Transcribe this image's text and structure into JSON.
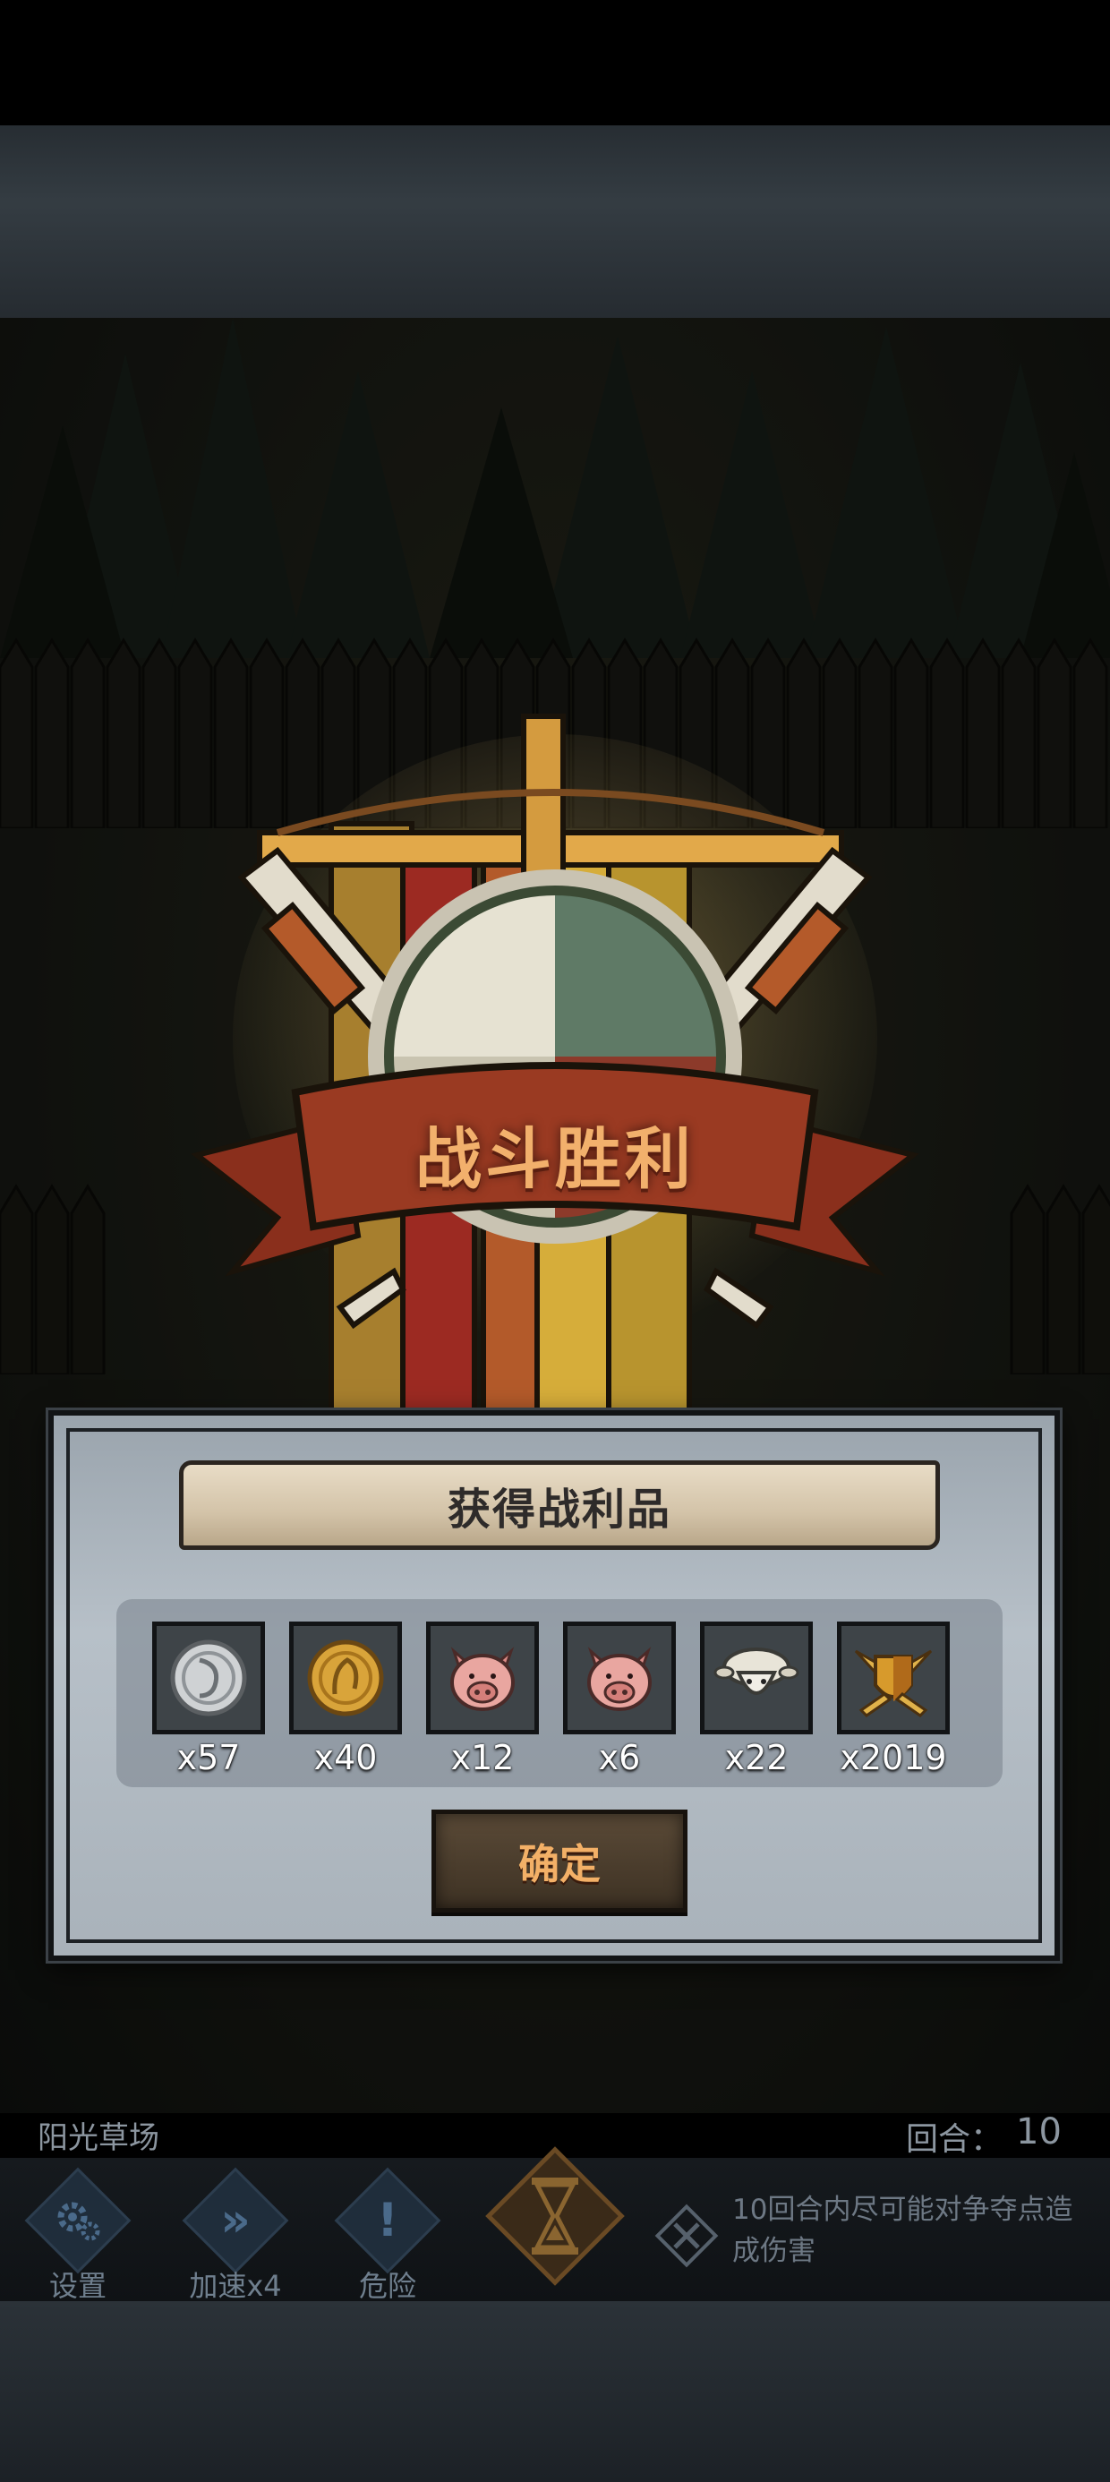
{
  "battle": {
    "result_title": "战斗胜利"
  },
  "loot_panel": {
    "title": "获得战利品",
    "confirm_label": "确定",
    "items": [
      {
        "icon": "silver-coin-icon",
        "count": "x57"
      },
      {
        "icon": "gold-coin-icon",
        "count": "x40"
      },
      {
        "icon": "pig-icon",
        "count": "x12"
      },
      {
        "icon": "pig-icon",
        "count": "x6"
      },
      {
        "icon": "sheep-icon",
        "count": "x22"
      },
      {
        "icon": "shield-crest-icon",
        "count": "x2019"
      }
    ]
  },
  "status": {
    "map_name": "阳光草场",
    "round_label": "回合：",
    "round_value": "10"
  },
  "toolbar": {
    "settings_label": "设置",
    "speed_label": "加速x4",
    "danger_label": "危险",
    "speed_glyph": "»",
    "danger_glyph": "!"
  },
  "objective": {
    "text": "10回合内尽可能对争夺点造成伤害"
  },
  "colors": {
    "title_orange": "#f2b06c",
    "panel_grey": "#b7c0c8",
    "ribbon_red": "#9a3a22"
  }
}
